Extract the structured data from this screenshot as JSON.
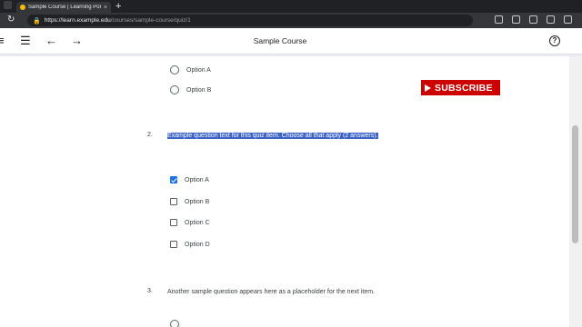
{
  "browser": {
    "tab_title": "Sample Course | Learning Portal",
    "tab_close": "×",
    "new_tab": "+",
    "url_host": "https://learn.example.edu",
    "url_path": "/courses/sample-course/quiz/1"
  },
  "header": {
    "title": "Sample Course",
    "help": "?"
  },
  "question1": {
    "options": [
      "Option A",
      "Option B"
    ]
  },
  "question2": {
    "number": "2.",
    "text": "Example question text for this quiz item. Choose all that apply (2 answers).",
    "options": [
      {
        "label": "Option A",
        "checked": true
      },
      {
        "label": "Option B",
        "checked": false
      },
      {
        "label": "Option C",
        "checked": false
      },
      {
        "label": "Option D",
        "checked": false
      }
    ]
  },
  "question3": {
    "number": "3.",
    "text": "Another sample question appears here as a placeholder for the next item."
  },
  "overlay": {
    "subscribe_label": "SUBSCRIBE",
    "color": "#cc0000"
  },
  "icons": [
    "back-icon",
    "forward-icon",
    "refresh-icon",
    "lock-icon",
    "menu-icon",
    "arrow-left-icon",
    "arrow-right-icon",
    "help-icon",
    "play-icon",
    "check-icon"
  ]
}
